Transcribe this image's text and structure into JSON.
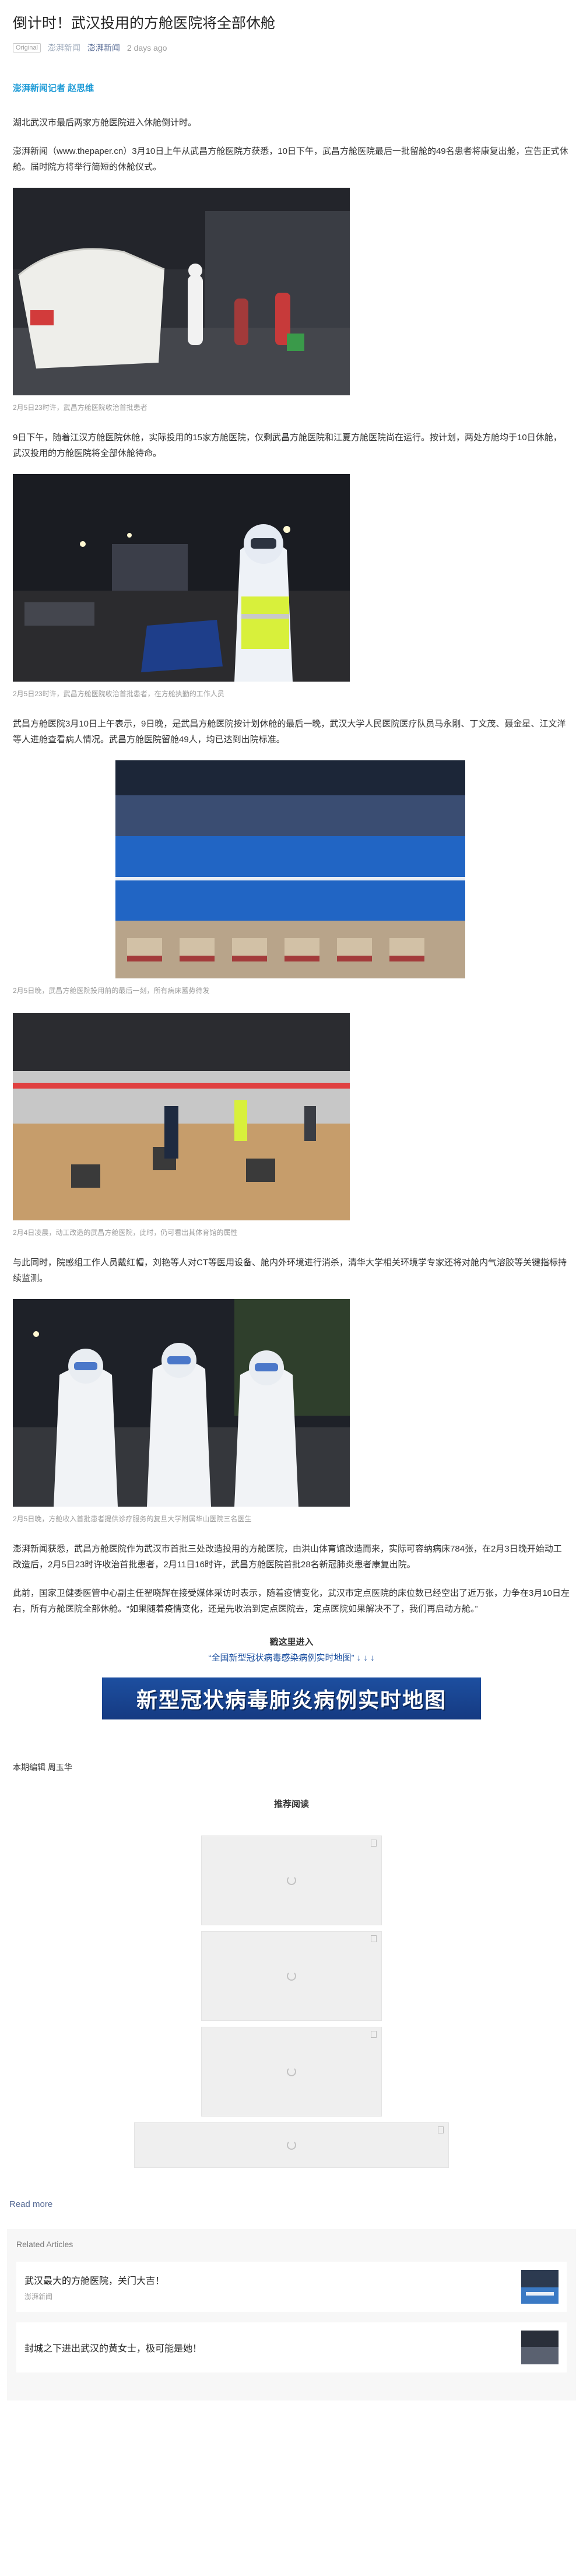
{
  "article": {
    "title": "倒计时！武汉投用的方舱医院将全部休舱",
    "meta": {
      "original_tag": "Original",
      "source_link": "澎湃新闻",
      "account": "澎湃新闻",
      "time": "2 days ago"
    },
    "reporter": "澎湃新闻记者 赵思维",
    "intro": "湖北武汉市最后两家方舱医院进入休舱倒计时。",
    "p1": "澎湃新闻（www.thepaper.cn）3月10日上午从武昌方舱医院方获悉，10日下午，武昌方舱医院最后一批留舱的49名患者将康复出舱，宣告正式休舱。届时院方将举行简短的休舱仪式。",
    "caption1": "2月5日23时许，武昌方舱医院收治首批患者",
    "p2": "9日下午，随着江汉方舱医院休舱，实际投用的15家方舱医院，仅剩武昌方舱医院和江夏方舱医院尚在运行。按计划，两处方舱均于10日休舱，武汉投用的方舱医院将全部休舱待命。",
    "caption2": "2月5日23时许，武昌方舱医院收治首批患者，在方舱执勤的工作人员",
    "p3": "武昌方舱医院3月10日上午表示，9日晚，是武昌方舱医院按计划休舱的最后一晚，武汉大学人民医院医疗队员马永刚、丁文茂、聂金星、江文洋等人进舱查看病人情况。武昌方舱医院留舱49人，均已达到出院标准。",
    "caption3": "2月5日晚，武昌方舱医院投用前的最后一刻，所有病床蓄势待发",
    "caption4": "2月4日凌晨，动工改造的武昌方舱医院，此时，仍可看出其体育馆的属性",
    "p4": "与此同时，院感组工作人员戴红帽，刘艳等人对CT等医用设备、舱内外环境进行消杀，清华大学相关环境学专家还将对舱内气溶胶等关键指标持续监测。",
    "caption5": "2月5日晚，方舱收入首批患者提供诊疗服务的复旦大学附属华山医院三名医生",
    "p5": "澎湃新闻获悉，武昌方舱医院作为武汉市首批三处改造投用的方舱医院，由洪山体育馆改造而来，实际可容纳病床784张，在2月3日晚开始动工改造后，2月5日23时许收治首批患者，2月11日16时许，武昌方舱医院首批28名新冠肺炎患者康复出院。",
    "p6": "此前，国家卫健委医管中心副主任翟晓辉在接受媒体采访时表示，随着疫情变化，武汉市定点医院的床位数已经空出了近万张，力争在3月10日左右，所有方舱医院全部休舱。“如果随着疫情变化，还是先收治到定点医院去，定点医院如果解决不了，我们再启动方舱。”",
    "cta": {
      "title": "戳这里进入",
      "link": "“全国新型冠状病毒感染病例实时地图” ↓ ↓ ↓",
      "banner": "新型冠状病毒肺炎病例实时地图"
    },
    "editor": "本期编辑 周玉华"
  },
  "recommend": {
    "title": "推荐阅读"
  },
  "read_more": "Read more",
  "related": {
    "heading": "Related Articles",
    "items": [
      {
        "title": "武汉最大的方舱医院，关门大吉！",
        "source": "澎湃新闻"
      },
      {
        "title": "封城之下进出武汉的黄女士，极可能是她！",
        "source": ""
      }
    ]
  },
  "colors": {
    "accent_blue": "#1c9ad6",
    "link_blue": "#576b95",
    "banner_blue": "#1d4fa0"
  }
}
